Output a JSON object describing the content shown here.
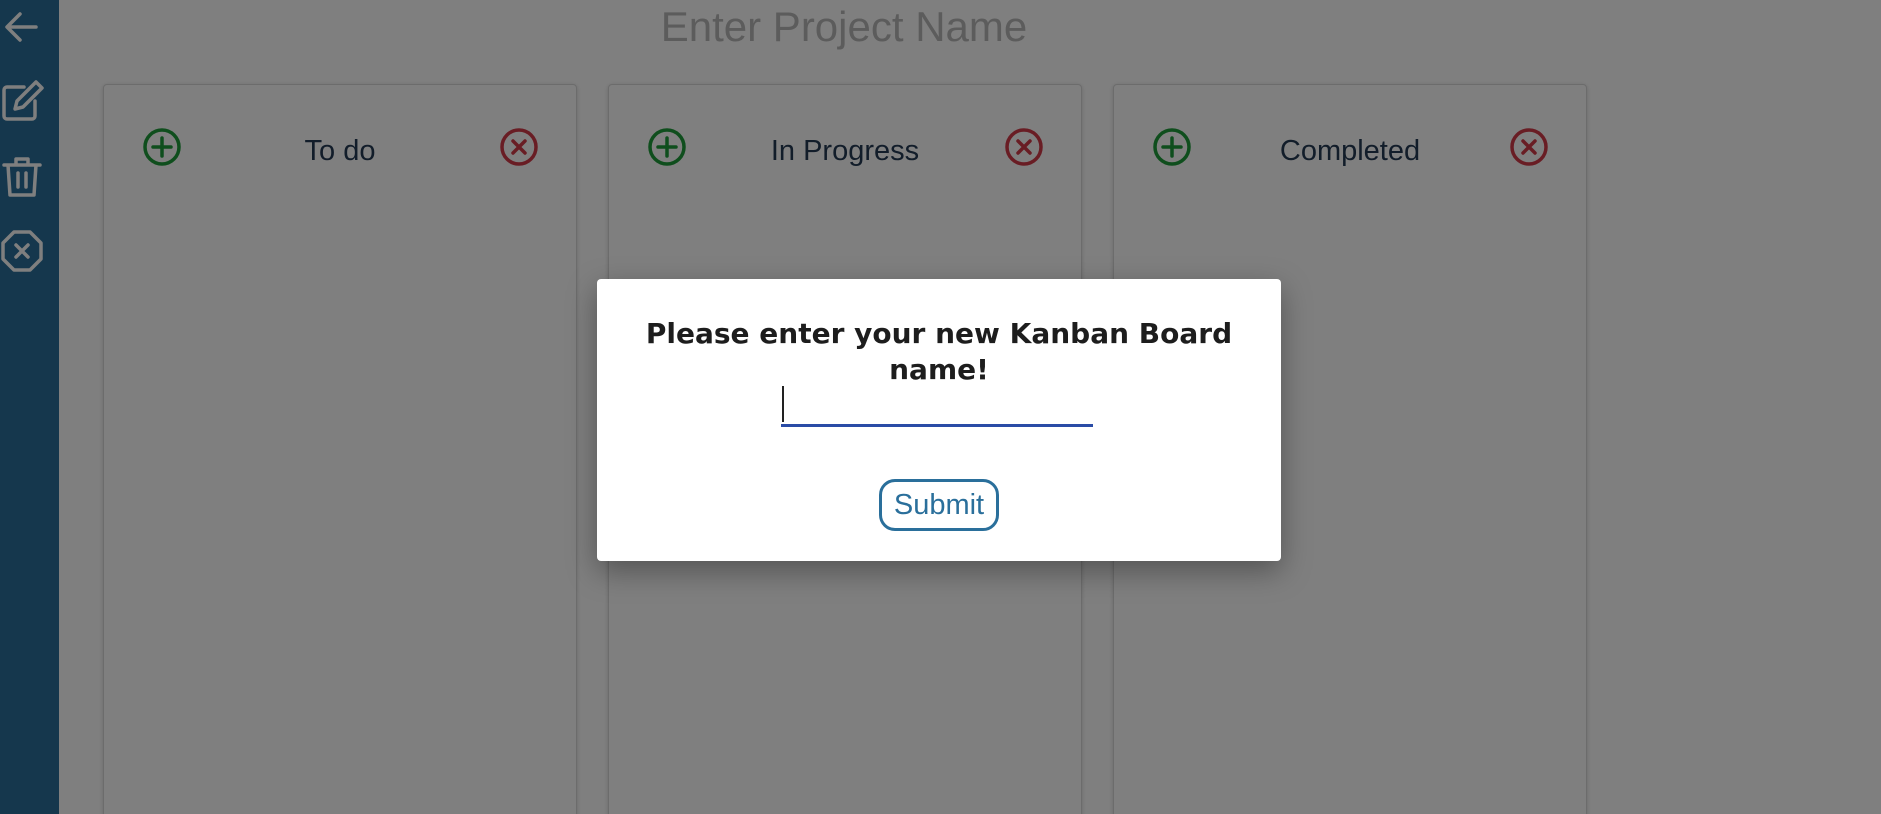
{
  "app": {
    "project_name_placeholder": "Enter Project Name"
  },
  "sidebar": {
    "items": [
      {
        "icon": "arrow-left-icon"
      },
      {
        "icon": "edit-icon"
      },
      {
        "icon": "trash-icon"
      },
      {
        "icon": "close-octagon-icon"
      }
    ]
  },
  "columns": [
    {
      "title": "To do"
    },
    {
      "title": "In Progress"
    },
    {
      "title": "Completed"
    }
  ],
  "modal": {
    "title": "Please enter your new Kanban Board name!",
    "input_value": "",
    "submit_label": "Submit"
  },
  "colors": {
    "sidebar": "#2a6f9b",
    "add": "#1f9d3a",
    "remove": "#d23a48",
    "input_underline": "#2a4ca6",
    "submit": "#2a6f9b"
  }
}
